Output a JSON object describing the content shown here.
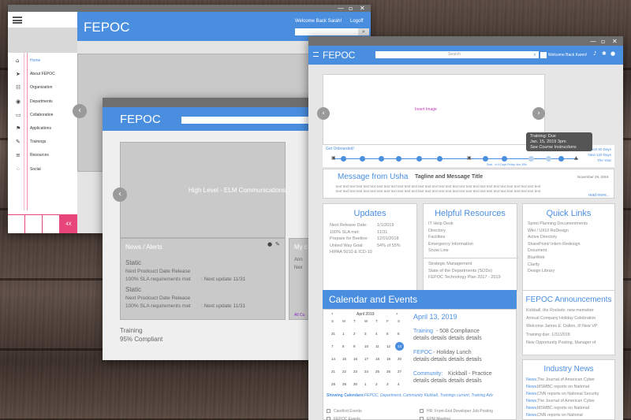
{
  "win_left": {
    "title": "FEPOC",
    "welcome": "Welcome Back Sarah!",
    "logoff": "Logoff",
    "nav": [
      "Home",
      "About FEPOC",
      "Organization",
      "Departments",
      "Collaboration",
      "Applications",
      "Trainings",
      "Resources",
      "Social"
    ],
    "footer_label": "4X"
  },
  "win_mid": {
    "title": "FEPOC",
    "banner": "High Level - ELM Communications",
    "news_title": "News / Alerts",
    "news_items": [
      {
        "head": "Static",
        "line1": "Next Prodouct Date Release",
        "line2a": "100% SLA requirements met",
        "line2b": ": Next update 11/31"
      },
      {
        "head": "Static",
        "line1": "Next Prodouct Date Release",
        "line2a": "100% SLA requirements met",
        "line2b": ": Next update 11/31"
      }
    ],
    "side_title": "My c",
    "side_l1": "Ann",
    "side_l2": "Nex",
    "side_link": "All Cu",
    "training_label": "Training",
    "training_value": "95% Compliant"
  },
  "win_right": {
    "title": "FEPOC",
    "search_placeholder": "Search",
    "welcome": "Welcome Back Karen!",
    "insert_image": "Insert Image",
    "tooltip": {
      "l1": "Training: Due",
      "l2": "Jan. 15, 2019  3pm",
      "l3": "See Course Instructions"
    },
    "onboard_label": "Get Onboarded!",
    "onboard_note": "Start - In 5 Days Friday Nov 30th",
    "onboard_links": [
      "Next 60 Days",
      "Next 120 Days",
      "The Year"
    ],
    "message": {
      "from": "Message from Usha",
      "tagline": "Tagline and Message Title",
      "date": "November 29, 2019",
      "body": "text text text text text text text text text text text text text text text text text text text text text text text text text text text text text text",
      "read_more": "read more..."
    },
    "updates": {
      "title": "Updates",
      "rows": [
        {
          "k": "Next Release Date:",
          "v": "1/1/2019"
        },
        {
          "k": "100% SLA  met:",
          "v": "11/31"
        },
        {
          "k": "Prepare for Beeline:",
          "v": "12/01/2018"
        },
        {
          "k": "United Way Goal:",
          "v": "54% of 55%"
        },
        {
          "k": "HIPAA 5010 & ICD-10",
          "v": ""
        }
      ]
    },
    "resources": {
      "title": "Helpful Resources",
      "group1": [
        "IT Help Desk",
        "Directory",
        "Facilities",
        "Emergency Information",
        "Snow Line"
      ],
      "group2": [
        "Strategic Management",
        "State of the Departments (SODs)",
        "FEPOC Technology Plan 2017 - 2019"
      ]
    },
    "quick": {
      "title": "Quick Links",
      "items": [
        "Sprint Planning Documentments",
        "Wiki / UXUI ReDesign",
        "Active Directory",
        "SharePoint/ Intern Redesign",
        "Document",
        "BlueWeb",
        "Clarity",
        "Design Library"
      ]
    },
    "calendar": {
      "title": "Calendar and Events",
      "month": "April 2019",
      "days": [
        "S",
        "M",
        "T",
        "W",
        "T",
        "F",
        "S"
      ],
      "weeks": [
        [
          "31",
          "1",
          "2",
          "3",
          "4",
          "5",
          "6"
        ],
        [
          "7",
          "8",
          "9",
          "10",
          "11",
          "12",
          "13"
        ],
        [
          "14",
          "15",
          "16",
          "17",
          "18",
          "19",
          "20"
        ],
        [
          "21",
          "22",
          "23",
          "24",
          "25",
          "26",
          "27"
        ],
        [
          "28",
          "29",
          "30",
          "1",
          "2",
          "3",
          "4"
        ]
      ],
      "selected": "13",
      "showing_label": "Showing Calendars:",
      "showing_list": "FEPOC, Department, Community Kickball, Trainings current, Training Adv",
      "event_date": "April 13, 2019",
      "events": [
        {
          "title": "Training",
          "suffix": " - 508 Compliance",
          "detail": "details details details details"
        },
        {
          "title": "FEPOC",
          "suffix": " - Holiday Lunch",
          "detail": "details details details details"
        },
        {
          "title": "Community:",
          "suffix": " Kickball  - Practice",
          "detail": "details details details details"
        }
      ],
      "checks": [
        "Carefirst Events",
        "HR: Front-End Developer Job Posting",
        "FEPOC Events",
        "EPM Meeting"
      ]
    },
    "announcements": {
      "title": "FEPOC Announcements",
      "items": [
        "Kickball, the Rockets: new memeber",
        "Annual Company Holiday Celebration",
        "Welcome James E. Dalton, III New VP",
        "Training due: 1/31/2018",
        "New Opportunity Posting, Manager of"
      ]
    },
    "industry": {
      "title": "Industry News",
      "items": [
        {
          "src": "News,",
          "txt": " The Journal of American Cyber"
        },
        {
          "src": "News,",
          "txt": " MSMBC reports on National"
        },
        {
          "src": "News,",
          "txt": " CNN reports on National Security"
        },
        {
          "src": "News,",
          "txt": " The Journal of American Cyber"
        },
        {
          "src": "News,",
          "txt": " MSMBC reports on National"
        },
        {
          "src": "News,",
          "txt": " CNN reports on National"
        }
      ]
    }
  },
  "colors": {
    "brand": "#4a8ee0",
    "titlebar": "#6f6f6f",
    "accent_pink": "#e8457a"
  }
}
